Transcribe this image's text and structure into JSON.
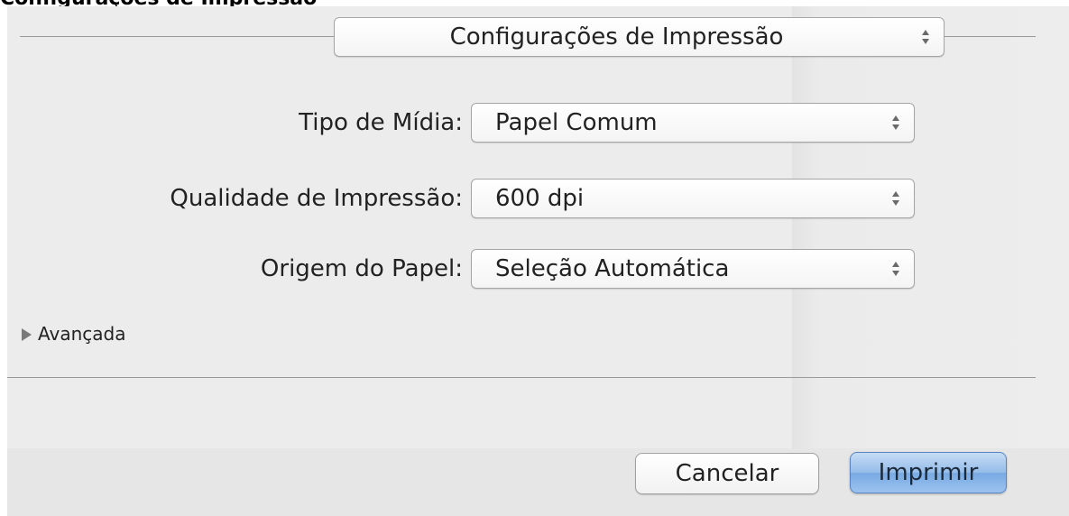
{
  "caption": {
    "text": "Configurações de Impressão"
  },
  "panel_selector": {
    "value": "Configurações de Impressão"
  },
  "fields": [
    {
      "label": "Tipo de Mídia:",
      "value": "Papel Comum"
    },
    {
      "label": "Qualidade de Impressão:",
      "value": "600 dpi"
    },
    {
      "label": "Origem do Papel:",
      "value": "Seleção Automática"
    }
  ],
  "advanced": {
    "label": "Avançada"
  },
  "buttons": {
    "cancel": "Cancelar",
    "print": "Imprimir"
  },
  "colors": {
    "dialog_background": "#ececec",
    "default_button": "#78a9e2"
  }
}
